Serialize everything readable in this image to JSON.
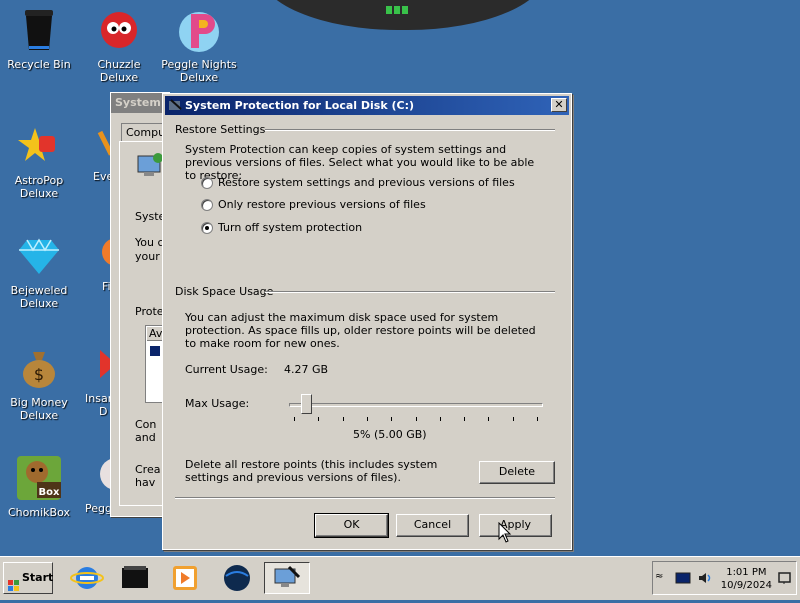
{
  "desktop": {
    "icons": [
      {
        "label": "Recycle Bin"
      },
      {
        "label": "Chuzzle Deluxe"
      },
      {
        "label": "Peggle Nights Deluxe"
      },
      {
        "label": "AstroPop Deluxe"
      },
      {
        "label": "Bejeweled Deluxe"
      },
      {
        "label": "Big Money Deluxe"
      },
      {
        "label": "ChomikBox"
      }
    ],
    "partial_labels": [
      "Eve",
      "Fi",
      "Insan",
      "D",
      "Pegg"
    ]
  },
  "background_window": {
    "title": "System",
    "tab": "Comput",
    "texts": [
      "Syster",
      "You c",
      "your",
      "Protec",
      "Av",
      "Con",
      "and",
      "Crea",
      "hav"
    ]
  },
  "dialog": {
    "title": "System Protection for Local Disk (C:)",
    "close_glyph": "✕",
    "restore_settings": {
      "heading": "Restore Settings",
      "description": "System Protection can keep copies of system settings and previous versions of files. Select what you would like to be able to restore:",
      "options": [
        {
          "label": "Restore system settings and previous versions of files",
          "selected": false
        },
        {
          "label": "Only restore previous versions of files",
          "selected": false
        },
        {
          "label": "Turn off system protection",
          "selected": true
        }
      ]
    },
    "disk_space": {
      "heading": "Disk Space Usage",
      "description": "You can adjust the maximum disk space used for system protection. As space fills up, older restore points will be deleted to make room for new ones.",
      "current_usage_label": "Current Usage:",
      "current_usage_value": "4.27 GB",
      "max_usage_label": "Max Usage:",
      "max_usage_value": "5% (5.00 GB)",
      "max_usage_percent": 5,
      "delete_text": "Delete all restore points (this includes system settings and previous versions of files).",
      "delete_button": "Delete"
    },
    "buttons": {
      "ok": "OK",
      "cancel": "Cancel",
      "apply": "Apply"
    }
  },
  "taskbar": {
    "start_label": "Start",
    "tray_expand_glyph": "≈",
    "clock_time": "1:01 PM",
    "clock_date": "10/9/2024"
  },
  "colors": {
    "desktop": "#3a6ea5",
    "titlebar_start": "#0a246a",
    "titlebar_end": "#2f63b8",
    "face": "#d4d0c8"
  }
}
